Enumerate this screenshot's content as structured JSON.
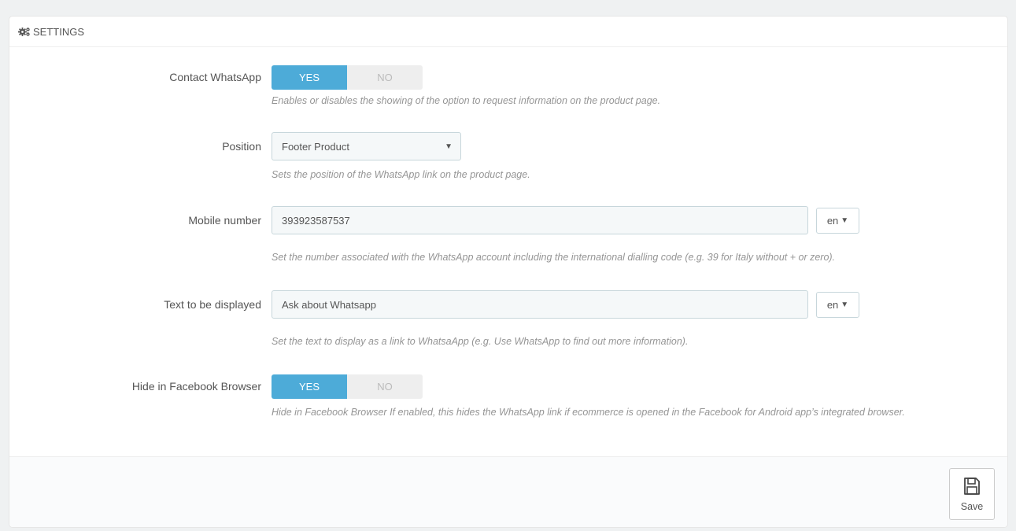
{
  "panel": {
    "title": "SETTINGS",
    "icon": "cogs-icon"
  },
  "fields": {
    "contact_whatsapp": {
      "label": "Contact WhatsApp",
      "yes": "YES",
      "no": "NO",
      "value": "YES",
      "help": "Enables or disables the showing of the option to request information on the product page."
    },
    "position": {
      "label": "Position",
      "value": "Footer Product",
      "help": "Sets the position of the WhatsApp link on the product page."
    },
    "mobile_number": {
      "label": "Mobile number",
      "value": "393923587537",
      "lang": "en",
      "help": "Set the number associated with the WhatsApp account including the international dialling code (e.g. 39 for Italy without + or zero)."
    },
    "text_displayed": {
      "label": "Text to be displayed",
      "value": "Ask about Whatsapp",
      "lang": "en",
      "help": "Set the text to display as a link to WhatsaApp (e.g. Use WhatsApp to find out more information)."
    },
    "hide_facebook": {
      "label": "Hide in Facebook Browser",
      "yes": "YES",
      "no": "NO",
      "value": "YES",
      "help": "Hide in Facebook Browser If enabled, this hides the WhatsApp link if ecommerce is opened in the Facebook for Android app’s integrated browser."
    }
  },
  "footer": {
    "save_label": "Save",
    "save_icon": "floppy-disk-icon"
  },
  "colors": {
    "accent": "#4dabd8",
    "off": "#eeeeee",
    "help_text": "#959595"
  }
}
